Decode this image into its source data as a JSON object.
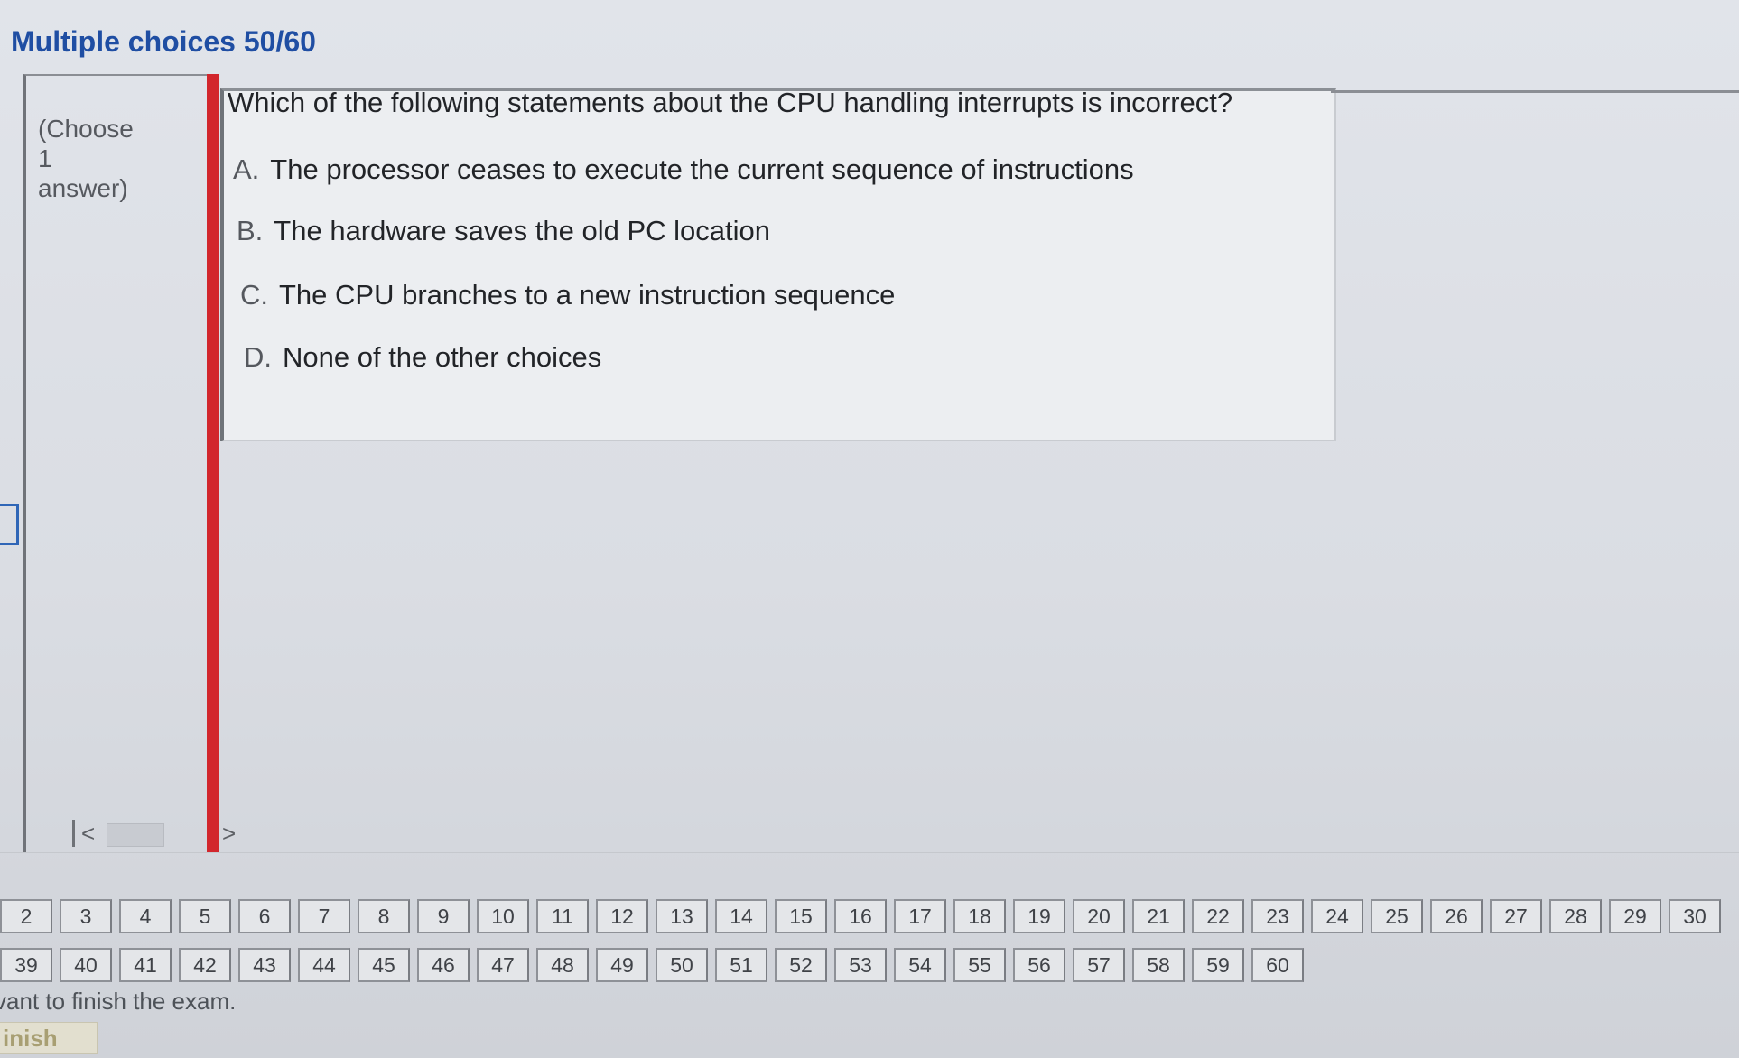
{
  "header": {
    "title": "Multiple choices 50/60"
  },
  "left_panel": {
    "choose_lines": [
      "(Choose",
      "1",
      "answer)"
    ],
    "scroll_left": "<",
    "scroll_right": ">"
  },
  "question": {
    "text": "Which of the following statements about the CPU handling interrupts is incorrect?",
    "options": [
      {
        "letter": "A.",
        "text": "The processor ceases to execute the current sequence of instructions"
      },
      {
        "letter": "B.",
        "text": "The hardware saves the old PC location"
      },
      {
        "letter": "C.",
        "text": "The CPU branches to a new instruction sequence"
      },
      {
        "letter": "D.",
        "text": "None of the other choices"
      }
    ]
  },
  "navigation": {
    "row1": [
      "2",
      "3",
      "4",
      "5",
      "6",
      "7",
      "8",
      "9",
      "10",
      "11",
      "12",
      "13",
      "14",
      "15",
      "16",
      "17",
      "18",
      "19",
      "20",
      "21",
      "22",
      "23",
      "24",
      "25",
      "26",
      "27",
      "28",
      "29",
      "30"
    ],
    "row2": [
      "39",
      "40",
      "41",
      "42",
      "43",
      "44",
      "45",
      "46",
      "47",
      "48",
      "49",
      "50",
      "51",
      "52",
      "53",
      "54",
      "55",
      "56",
      "57",
      "58",
      "59",
      "60"
    ]
  },
  "footer": {
    "finish_prompt": "vant to finish the exam.",
    "finish_label": "inish"
  }
}
